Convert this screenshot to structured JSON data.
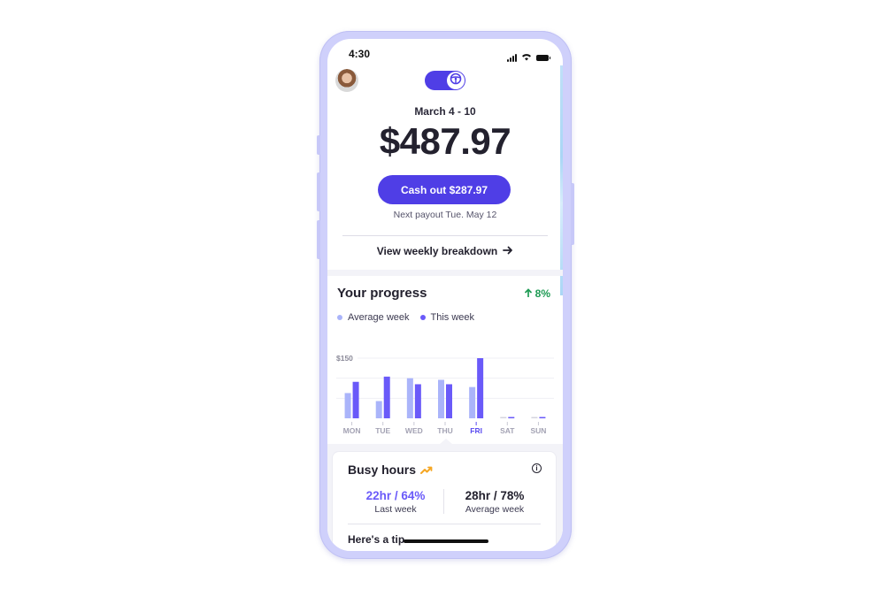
{
  "status_bar": {
    "time": "4:30",
    "icons": [
      "signal-icon",
      "wifi-icon",
      "battery-icon"
    ]
  },
  "header": {
    "avatar": "avatar",
    "mode_toggle": {
      "state": "on",
      "icon": "steering-wheel-icon"
    }
  },
  "earnings": {
    "period": "March 4 - 10",
    "total": "$487.97",
    "cashout_label": "Cash out $287.97",
    "next_payout": "Next payout Tue. May 12",
    "breakdown_link": "View weekly breakdown"
  },
  "progress": {
    "title": "Your progress",
    "change": "8%",
    "change_direction": "up",
    "legend": [
      "Average week",
      "This week"
    ]
  },
  "colors": {
    "accent": "#4f3ee6",
    "average_bar": "#aab4fa",
    "this_week_bar": "#6a5af9",
    "positive": "#1e9b54",
    "highlight_day": "#5b4cf0",
    "busy_icon": "#f5a623"
  },
  "chart_data": {
    "type": "bar",
    "title": "Your progress",
    "categories": [
      "MON",
      "TUE",
      "WED",
      "THU",
      "FRI",
      "SAT",
      "SUN"
    ],
    "highlighted_category": "FRI",
    "series": [
      {
        "name": "Average week",
        "values": [
          63,
          43,
          100,
          96,
          78,
          0,
          0
        ]
      },
      {
        "name": "This week",
        "values": [
          91,
          104,
          85,
          85,
          150,
          0,
          0
        ]
      }
    ],
    "y_tick_labels": [
      "$150"
    ],
    "gridlines": [
      50,
      100,
      150
    ],
    "ylim": [
      0,
      150
    ],
    "xlabel": "",
    "ylabel": "",
    "legend_position": "top-left",
    "grid": true
  },
  "busy_hours": {
    "title": "Busy hours",
    "last_week_value": "22hr / 64%",
    "last_week_label": "Last week",
    "average_value": "28hr / 78%",
    "average_label": "Average week",
    "tip_label": "Here's a tip"
  }
}
